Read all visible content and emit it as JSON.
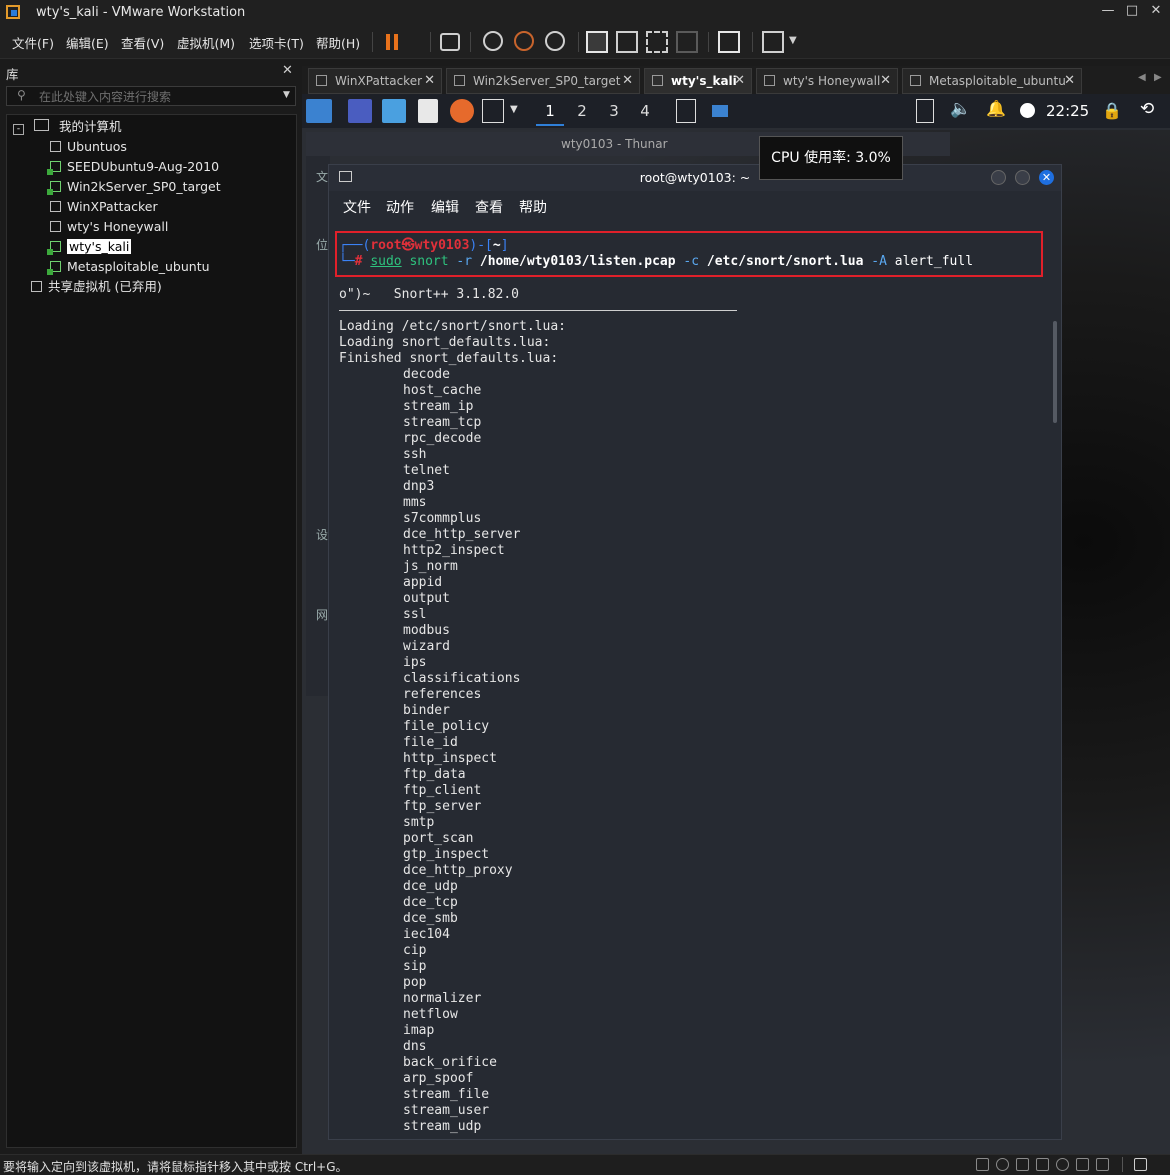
{
  "window": {
    "title": "wty's_kali - VMware Workstation"
  },
  "menubar": {
    "items": [
      "文件(F)",
      "编辑(E)",
      "查看(V)",
      "虚拟机(M)",
      "选项卡(T)",
      "帮助(H)"
    ]
  },
  "library": {
    "title": "库",
    "search_placeholder": "在此处键入内容进行搜索",
    "root": "我的计算机",
    "vms": [
      "Ubuntuos",
      "SEEDUbuntu9-Aug-2010",
      "Win2kServer_SP0_target",
      "WinXPattacker",
      "wty's Honeywall",
      "wty's_kali",
      "Metasploitable_ubuntu"
    ],
    "shared": "共享虚拟机 (已弃用)"
  },
  "tabs": [
    "WinXPattacker",
    "Win2kServer_SP0_target",
    "wty's_kali",
    "wty's Honeywall",
    "Metasploitable_ubuntu"
  ],
  "kali_panel": {
    "workspaces": [
      "1",
      "2",
      "3",
      "4"
    ],
    "clock": "22:25"
  },
  "thunar": {
    "title": "wty0103 - Thunar",
    "labels": [
      "文",
      "位",
      "设",
      "网"
    ]
  },
  "tooltip": {
    "cpu": "CPU 使用率: 3.0%"
  },
  "terminal": {
    "title": "root@wty0103: ~",
    "menu": [
      "文件",
      "动作",
      "编辑",
      "查看",
      "帮助"
    ],
    "prompt_user": "root㉿wty0103",
    "prompt_dir": "~",
    "command": {
      "sudo": "sudo",
      "snort": "snort",
      "flag_r": "-r",
      "pcap": "/home/wty0103/listen.pcap",
      "flag_c": "-c",
      "lua": "/etc/snort/snort.lua",
      "flag_A": "-A",
      "mode": "alert_full"
    },
    "banner": "o\")~   Snort++ 3.1.82.0",
    "loading": [
      "Loading /etc/snort/snort.lua:",
      "Loading snort_defaults.lua:",
      "Finished snort_defaults.lua:"
    ],
    "modules": [
      "decode",
      "host_cache",
      "stream_ip",
      "stream_tcp",
      "rpc_decode",
      "ssh",
      "telnet",
      "dnp3",
      "mms",
      "s7commplus",
      "dce_http_server",
      "http2_inspect",
      "js_norm",
      "appid",
      "output",
      "ssl",
      "modbus",
      "wizard",
      "ips",
      "classifications",
      "references",
      "binder",
      "file_policy",
      "file_id",
      "http_inspect",
      "ftp_data",
      "ftp_client",
      "ftp_server",
      "smtp",
      "port_scan",
      "gtp_inspect",
      "dce_http_proxy",
      "dce_udp",
      "dce_tcp",
      "dce_smb",
      "iec104",
      "cip",
      "sip",
      "pop",
      "normalizer",
      "netflow",
      "imap",
      "dns",
      "back_orifice",
      "arp_spoof",
      "stream_file",
      "stream_user",
      "stream_udp"
    ]
  },
  "statusbar": {
    "text": "要将输入定向到该虚拟机，请将鼠标指针移入其中或按 Ctrl+G。"
  },
  "colors": {
    "accent": "#2f7fd8",
    "highlight_box": "#e0202a",
    "prompt_red": "#e0303a",
    "prompt_blue": "#3b82f6",
    "cmd_green": "#2ec27e",
    "cmd_blue": "#5aa8f0"
  }
}
